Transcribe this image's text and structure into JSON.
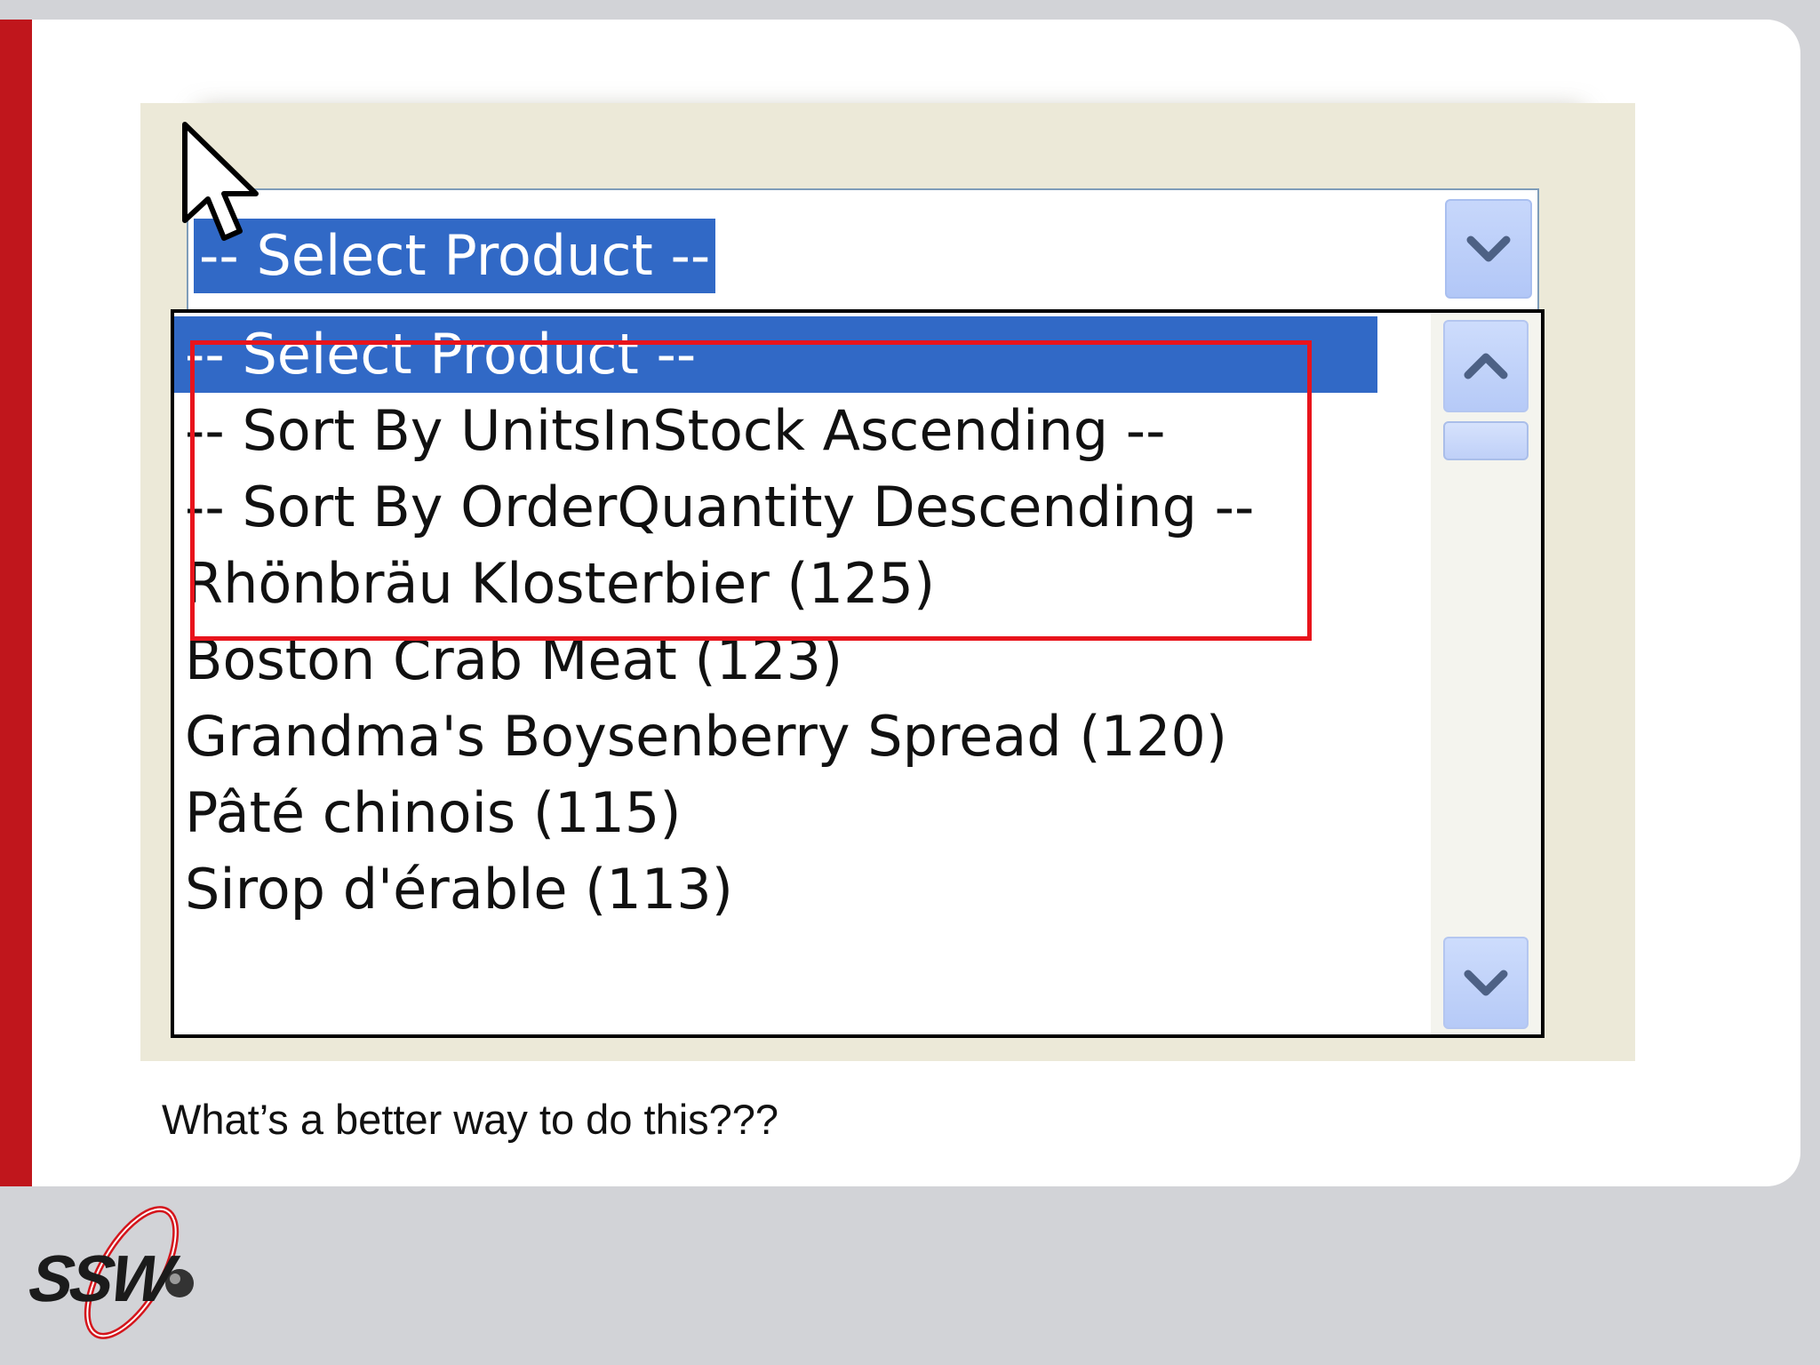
{
  "combo": {
    "selected_text": "-- Select Product --"
  },
  "dropdown": {
    "items": [
      "-- Select Product --",
      "-- Sort By UnitsInStock Ascending --",
      "-- Sort By OrderQuantity Descending --",
      "Rhönbräu Klosterbier (125)",
      "Boston Crab Meat (123)",
      "Grandma's Boysenberry Spread (120)",
      "Pâté chinois (115)",
      "Sirop d'érable (113)"
    ],
    "selected_index": 0
  },
  "slide": {
    "caption": "What’s a better way to do this???"
  },
  "logo": {
    "text": "SSW"
  },
  "colors": {
    "accent": "#c0161c",
    "highlight_box": "#e8141c",
    "selection": "#3169c6"
  },
  "icons": {
    "cursor": "arrow-cursor-icon",
    "combo_arrow": "chevron-down-icon",
    "scroll_up": "chevron-up-icon",
    "scroll_down": "chevron-down-icon"
  }
}
